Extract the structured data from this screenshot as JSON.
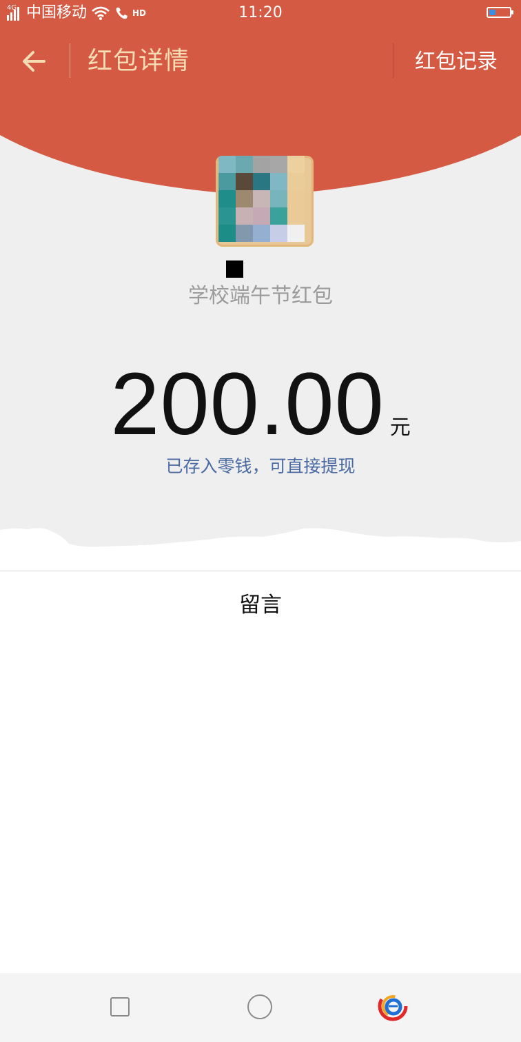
{
  "status_bar": {
    "network": "4G",
    "carrier": "中国移动",
    "hd": "HD",
    "time": "11:20"
  },
  "nav": {
    "title": "红包详情",
    "records": "红包记录"
  },
  "packet": {
    "sender_name": "■",
    "title": "学校端午节红包",
    "amount": "200.00",
    "currency": "元",
    "status": "已存入零钱，可直接提现"
  },
  "message": {
    "title": "留言"
  },
  "colors": {
    "header_red": "#d55a43",
    "title_gold": "#f6dcb5",
    "link_blue": "#4a6aa3",
    "background": "#efefef"
  }
}
